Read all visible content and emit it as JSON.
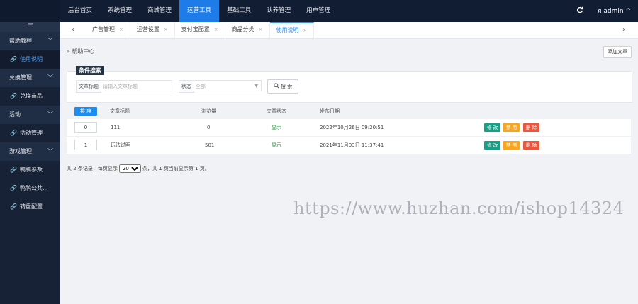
{
  "topnav": {
    "items": [
      {
        "label": "后台首页",
        "active": false
      },
      {
        "label": "系统管理",
        "active": false
      },
      {
        "label": "商城管理",
        "active": false
      },
      {
        "label": "运营工具",
        "active": true
      },
      {
        "label": "基础工具",
        "active": false
      },
      {
        "label": "认养管理",
        "active": false
      },
      {
        "label": "用户管理",
        "active": false
      }
    ],
    "refresh_icon": "refresh-icon",
    "user": "ᴙ admin ^"
  },
  "sidebar": {
    "toggle": "☰",
    "items": [
      {
        "label": "帮助教程",
        "type": "group"
      },
      {
        "label": "使用说明",
        "type": "link",
        "active": true
      },
      {
        "label": "兑换管理",
        "type": "group"
      },
      {
        "label": "兑换商品",
        "type": "link"
      },
      {
        "label": "活动",
        "type": "group"
      },
      {
        "label": "活动管理",
        "type": "link"
      },
      {
        "label": "游戏管理",
        "type": "group"
      },
      {
        "label": "鸭鸭参数",
        "type": "link"
      },
      {
        "label": "鸭鸭公共...",
        "type": "link"
      },
      {
        "label": "转盘配置",
        "type": "link"
      }
    ]
  },
  "tabs": {
    "items": [
      {
        "label": "广告管理",
        "active": false
      },
      {
        "label": "运营设置",
        "active": false
      },
      {
        "label": "支付宝配置",
        "active": false
      },
      {
        "label": "商品分类",
        "active": false
      },
      {
        "label": "使用说明",
        "active": true
      }
    ],
    "close": "×",
    "prev": "‹",
    "next": "›"
  },
  "page": {
    "breadcrumb": "» 帮助中心",
    "add_button": "添加文章"
  },
  "search": {
    "title": "条件搜索",
    "title_label": "文章标题",
    "title_placeholder": "请输入文章标题",
    "status_label": "状态",
    "status_value": "全部",
    "button": "搜 索"
  },
  "table": {
    "sort_button": "排 序",
    "columns": [
      "文章标题",
      "浏览量",
      "文章状态",
      "发布日期"
    ],
    "rows": [
      {
        "sort": "0",
        "title": "111",
        "views": "0",
        "status": "显示",
        "date": "2022年10月26日 09:20:51"
      },
      {
        "sort": "1",
        "title": "玩法说明",
        "views": "501",
        "status": "显示",
        "date": "2021年11月03日 11:37:41"
      }
    ],
    "actions": {
      "edit": "修 改",
      "disable": "禁 用",
      "delete": "删 除"
    }
  },
  "pager": {
    "prefix": "共 2 条记录，每页显示",
    "page_size": "20",
    "suffix": "条，共 1 页当前显示第 1 页。"
  },
  "watermark": "https://www.huzhan.com/ishop14324",
  "colors": {
    "topbar": "#111d33",
    "sidebar": "#172236",
    "accent": "#1e7ce8",
    "edit": "#16a085",
    "disable": "#f5a623",
    "delete": "#e9573f"
  }
}
